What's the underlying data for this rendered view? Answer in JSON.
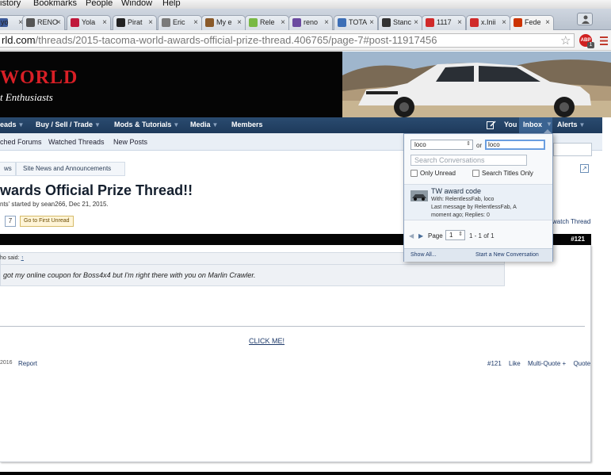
{
  "os_menu": {
    "items": [
      "istory",
      "Bookmarks",
      "People",
      "Window",
      "Help"
    ]
  },
  "browser": {
    "tabs": [
      {
        "label": "yo",
        "favicon_color": "#3b5998"
      },
      {
        "label": "RENO",
        "favicon_color": "#555555"
      },
      {
        "label": "Yola",
        "favicon_color": "#c0183c"
      },
      {
        "label": "Pirat",
        "favicon_color": "#222222"
      },
      {
        "label": "Eric",
        "favicon_color": "#7a7a7a"
      },
      {
        "label": "My e",
        "favicon_color": "#8a5a2a"
      },
      {
        "label": "Rele",
        "favicon_color": "#79b944"
      },
      {
        "label": "reno",
        "favicon_color": "#6b4aa0"
      },
      {
        "label": "TOTA",
        "favicon_color": "#3d6fb6"
      },
      {
        "label": "Stanc",
        "favicon_color": "#333333"
      },
      {
        "label": "1117",
        "favicon_color": "#d02a2a"
      },
      {
        "label": "x.Inii",
        "favicon_color": "#d02a2a"
      },
      {
        "label": "Fede",
        "favicon_color": "#cc3300"
      }
    ],
    "close_glyph": "×",
    "url_host": "rld.com",
    "url_path": "/threads/2015-tacoma-world-awards-official-prize-thread.406765/page-7#post-11917456",
    "abp_label": "ABP",
    "abp_count": "1"
  },
  "site": {
    "logo_main": "WORLD",
    "logo_sub": "t Enthusiasts",
    "nav": {
      "threads": "eads",
      "buy_sell": "Buy / Sell / Trade",
      "mods": "Mods & Tutorials",
      "media": "Media",
      "members": "Members",
      "you": "You",
      "inbox": "Inbox",
      "alerts": "Alerts",
      "arrow": "▼"
    },
    "subnav": {
      "watched_forums": "ched Forums",
      "watched_threads": "Watched Threads",
      "new_posts": "New Posts"
    },
    "breadcrumb": {
      "news": "ws",
      "site_news": "Site News and Announcements",
      "jump": "↗"
    }
  },
  "thread": {
    "title": "wards Official Prize Thread!!",
    "meta": "nts' started by sean266, Dec 21, 2015.",
    "page_7": "7",
    "go_first_unread": "Go to First Unread",
    "watch": "watch Thread"
  },
  "post": {
    "number": "#121",
    "quote_attrib": "ho said: ",
    "quote_up": "↑",
    "quote_text": "got my online coupon for Boss4x4 but I'm right there with you on Marlin Crawler.",
    "click_me": "CLICK ME!",
    "date": "2016",
    "report": "Report",
    "actions": {
      "number": "#121",
      "like": "Like",
      "multiquote": "Multi-Quote +",
      "quote": "Quote"
    }
  },
  "inbox_popup": {
    "filter_value": "loco",
    "updown": "⇕",
    "or_label": "or",
    "name_value": "loco",
    "search_placeholder": "Search Conversations",
    "only_unread": "Only Unread",
    "search_titles_only": "Search Titles Only",
    "conversation": {
      "title": "TW award code",
      "with": "With: RelentlessFab, loco",
      "last_message": "Last message by RelentlessFab, A",
      "time": "moment ago; Replies: 0"
    },
    "pagination": {
      "prev": "◀",
      "next": "▶",
      "page_label": "Page",
      "page_value": "1",
      "range": "1 - 1 of 1"
    },
    "show_all": "Show All...",
    "new_conversation": "Start a New Conversation"
  },
  "colors": {
    "logo_red": "#d91f26",
    "nav_blue": "#1e3a5c",
    "inbox_active": "#3b6391",
    "link_blue": "#1e3a6a"
  }
}
